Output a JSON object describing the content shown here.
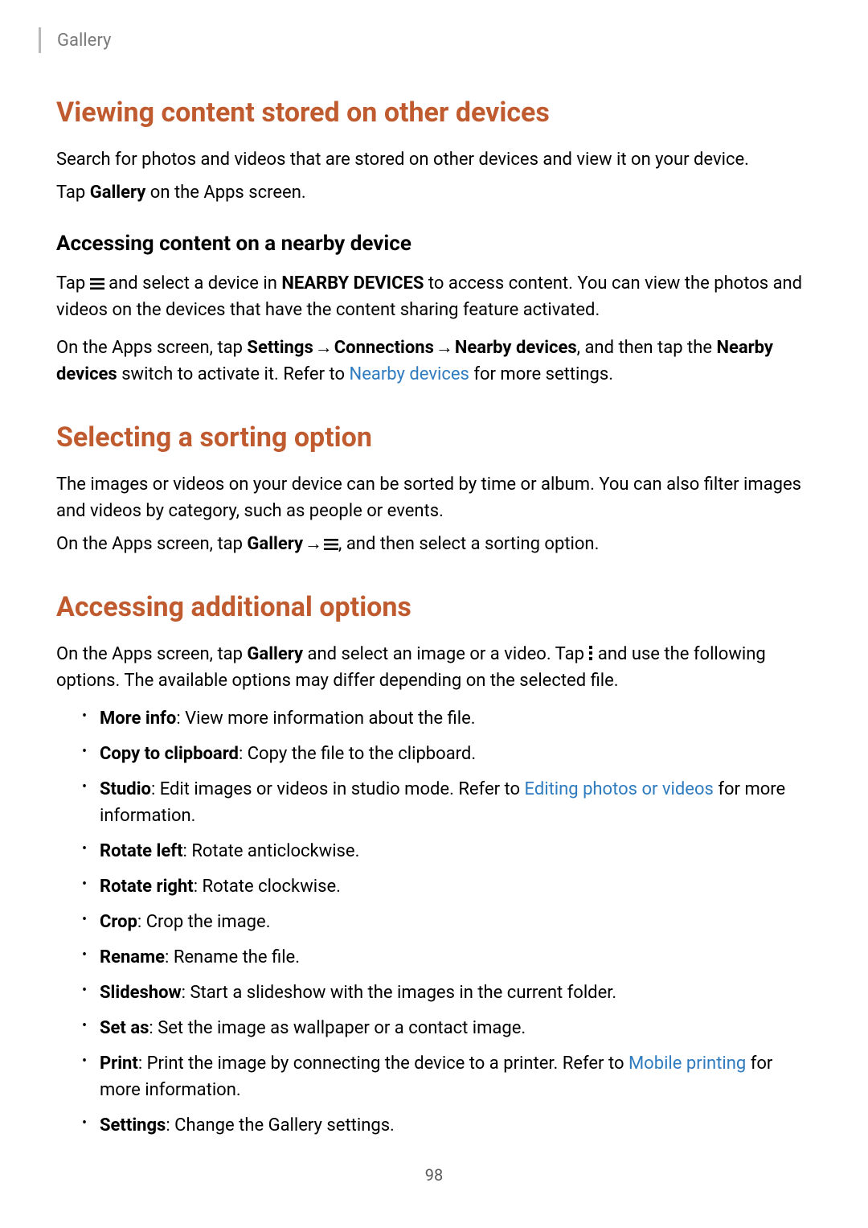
{
  "breadcrumb": "Gallery",
  "section1": {
    "title": "Viewing content stored on other devices",
    "p1": "Search for photos and videos that are stored on other devices and view it on your device.",
    "p2_pre": "Tap ",
    "p2_bold": "Gallery",
    "p2_post": " on the Apps screen.",
    "sub_title": "Accessing content on a nearby device",
    "sub_p1_pre": "Tap ",
    "sub_p1_mid": " and select a device in ",
    "sub_p1_bold": "NEARBY DEVICES",
    "sub_p1_post": " to access content. You can view the photos and videos on the devices that have the content sharing feature activated.",
    "sub_p2_pre": "On the Apps screen, tap ",
    "sub_p2_b1": "Settings",
    "sub_p2_arrow1": " → ",
    "sub_p2_b2": "Connections",
    "sub_p2_arrow2": " → ",
    "sub_p2_b3": "Nearby devices",
    "sub_p2_mid": ", and then tap the ",
    "sub_p2_b4": "Nearby devices",
    "sub_p2_mid2": " switch to activate it. Refer to ",
    "sub_p2_link": "Nearby devices",
    "sub_p2_post": " for more settings."
  },
  "section2": {
    "title": "Selecting a sorting option",
    "p1": "The images or videos on your device can be sorted by time or album. You can also filter images and videos by category, such as people or events.",
    "p2_pre": "On the Apps screen, tap ",
    "p2_bold": "Gallery",
    "p2_arrow": " → ",
    "p2_post": ", and then select a sorting option."
  },
  "section3": {
    "title": "Accessing additional options",
    "p1_pre": "On the Apps screen, tap ",
    "p1_bold": "Gallery",
    "p1_mid": " and select an image or a video. Tap ",
    "p1_post": " and use the following options. The available options may differ depending on the selected file.",
    "items": [
      {
        "b": "More info",
        "t": ": View more information about the file."
      },
      {
        "b": "Copy to clipboard",
        "t": ": Copy the file to the clipboard."
      },
      {
        "b": "Studio",
        "t_pre": ": Edit images or videos in studio mode. Refer to ",
        "link": "Editing photos or videos",
        "t_post": " for more information."
      },
      {
        "b": "Rotate left",
        "t": ": Rotate anticlockwise."
      },
      {
        "b": "Rotate right",
        "t": ": Rotate clockwise."
      },
      {
        "b": "Crop",
        "t": ": Crop the image."
      },
      {
        "b": "Rename",
        "t": ": Rename the file."
      },
      {
        "b": "Slideshow",
        "t": ": Start a slideshow with the images in the current folder."
      },
      {
        "b": "Set as",
        "t": ": Set the image as wallpaper or a contact image."
      },
      {
        "b": "Print",
        "t_pre": ": Print the image by connecting the device to a printer. Refer to ",
        "link": "Mobile printing",
        "t_post": " for more information."
      },
      {
        "b": "Settings",
        "t": ": Change the Gallery settings."
      }
    ]
  },
  "page_number": "98"
}
